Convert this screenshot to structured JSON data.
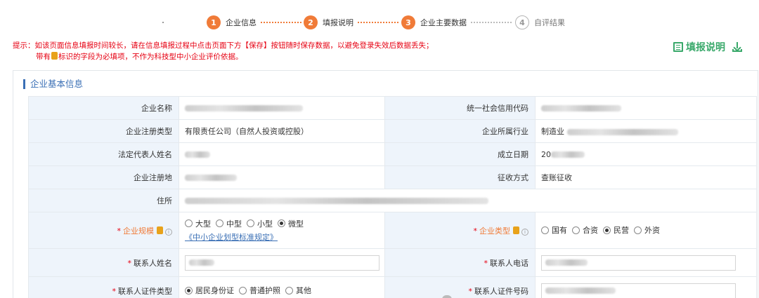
{
  "steps": [
    {
      "num": "1",
      "label": "企业信息",
      "done": true
    },
    {
      "num": "2",
      "label": "填报说明",
      "done": true
    },
    {
      "num": "3",
      "label": "企业主要数据",
      "done": true
    },
    {
      "num": "4",
      "label": "自评结果",
      "done": false
    }
  ],
  "notice": {
    "line1": "提示：如该页面信息填报时间较长，请在信息填报过程中点击页面下方【保存】按钮随时保存数据，以避免登录失效后数据丢失；",
    "line2_pre": "带有",
    "line2_post": "标识的字段为必填项，不作为科技型中小企业评价依据。"
  },
  "guide_label": "填报说明",
  "section_title": "企业基本信息",
  "fields": {
    "company_name": "企业名称",
    "credit_code": "统一社会信用代码",
    "reg_type": "企业注册类型",
    "reg_type_value": "有限责任公司（自然人投资或控股）",
    "industry": "企业所属行业",
    "industry_value_prefix": "制造业",
    "legal_rep": "法定代表人姓名",
    "est_date": "成立日期",
    "est_date_value_prefix": "20",
    "reg_place": "企业注册地",
    "tax_method": "征收方式",
    "tax_method_value": "查账征收",
    "address": "住所",
    "scale": "企业规模",
    "scale_options": [
      "大型",
      "中型",
      "小型",
      "微型"
    ],
    "scale_selected": 3,
    "scale_link": "《中小企业划型标准规定》",
    "ent_type": "企业类型",
    "ent_type_options": [
      "国有",
      "合资",
      "民营",
      "外资"
    ],
    "ent_type_selected": 2,
    "contact_name": "联系人姓名",
    "contact_phone": "联系人电话",
    "id_type": "联系人证件类型",
    "id_type_options": [
      "居民身份证",
      "普通护照",
      "其他"
    ],
    "id_type_selected": 0,
    "id_number": "联系人证件号码"
  },
  "required_mark": "*",
  "colors": {
    "accent": "#f07b38",
    "notice": "#e60012",
    "guide": "#3aa96b",
    "title": "#3a6fb5",
    "label_bg": "#eef4fb"
  },
  "icons": {
    "guide": "book-list-icon",
    "download": "download-icon",
    "tag": "tag-icon",
    "info": "info-circle-icon"
  }
}
